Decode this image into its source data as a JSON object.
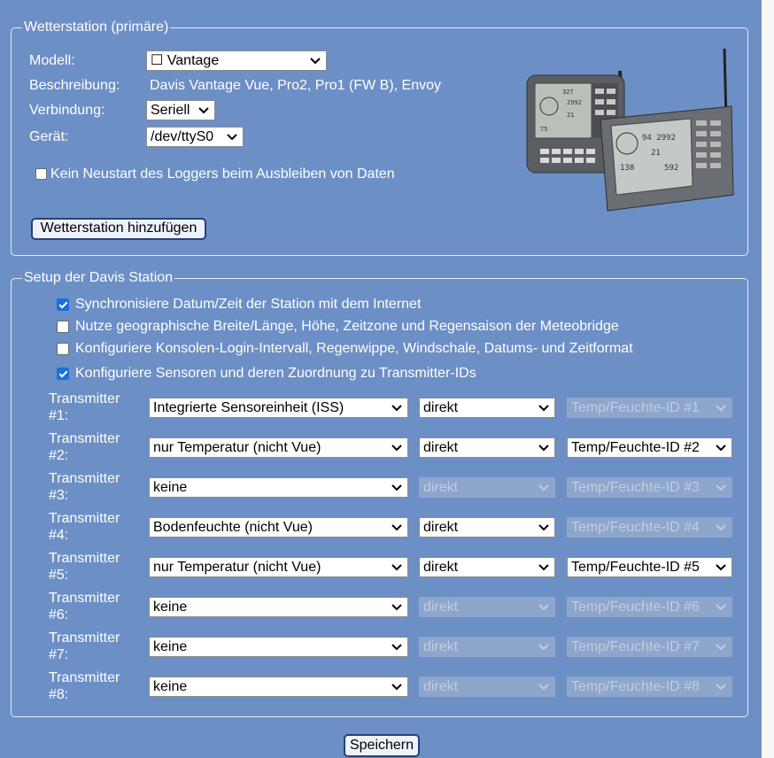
{
  "station": {
    "legend": "Wetterstation (primäre)",
    "model_label": "Modell:",
    "model_value": "☐ Vantage",
    "description_label": "Beschreibung:",
    "description_value": "Davis Vantage Vue, Pro2, Pro1 (FW B), Envoy",
    "connection_label": "Verbindung:",
    "connection_value": "Seriell",
    "device_label": "Gerät:",
    "device_value": "/dev/ttyS0",
    "no_restart_label": "Kein Neustart des Loggers beim Ausbleiben von Daten",
    "no_restart_checked": false,
    "add_button": "Wetterstation hinzufügen",
    "image_name": "davis-vantage-console-image"
  },
  "setup": {
    "legend": "Setup der Davis Station",
    "options": [
      {
        "label": "Synchronisiere Datum/Zeit der Station mit dem Internet",
        "checked": true
      },
      {
        "label": "Nutze geographische Breite/Länge, Höhe, Zeitzone und Regensaison der Meteobridge",
        "checked": false
      },
      {
        "label": "Konfiguriere Konsolen-Login-Intervall, Regenwippe, Windschale, Datums- und Zeitformat",
        "checked": false
      },
      {
        "label": "Konfiguriere Sensoren und deren Zuordnung zu Transmitter-IDs",
        "checked": true
      }
    ],
    "transmitters": [
      {
        "line1": "Transmitter",
        "line2": "#1:",
        "sensor": "Integrierte Sensoreinheit (ISS)",
        "mode": "direkt",
        "mode_disabled": false,
        "id": "Temp/Feuchte-ID #1",
        "id_disabled": true
      },
      {
        "line1": "Transmitter",
        "line2": "#2:",
        "sensor": "nur Temperatur (nicht Vue)",
        "mode": "direkt",
        "mode_disabled": false,
        "id": "Temp/Feuchte-ID #2",
        "id_disabled": false
      },
      {
        "line1": "Transmitter",
        "line2": "#3:",
        "sensor": "keine",
        "mode": "direkt",
        "mode_disabled": true,
        "id": "Temp/Feuchte-ID #3",
        "id_disabled": true
      },
      {
        "line1": "Transmitter",
        "line2": "#4:",
        "sensor": "Bodenfeuchte (nicht Vue)",
        "mode": "direkt",
        "mode_disabled": false,
        "id": "Temp/Feuchte-ID #4",
        "id_disabled": true
      },
      {
        "line1": "Transmitter",
        "line2": "#5:",
        "sensor": "nur Temperatur (nicht Vue)",
        "mode": "direkt",
        "mode_disabled": false,
        "id": "Temp/Feuchte-ID #5",
        "id_disabled": false
      },
      {
        "line1": "Transmitter",
        "line2": "#6:",
        "sensor": "keine",
        "mode": "direkt",
        "mode_disabled": true,
        "id": "Temp/Feuchte-ID #6",
        "id_disabled": true
      },
      {
        "line1": "Transmitter",
        "line2": "#7:",
        "sensor": "keine",
        "mode": "direkt",
        "mode_disabled": true,
        "id": "Temp/Feuchte-ID #7",
        "id_disabled": true
      },
      {
        "line1": "Transmitter",
        "line2": "#8:",
        "sensor": "keine",
        "mode": "direkt",
        "mode_disabled": true,
        "id": "Temp/Feuchte-ID #8",
        "id_disabled": true
      }
    ]
  },
  "save_button": "Speichern",
  "colors": {
    "background": "#6c8fc6",
    "checkbox_checked": "#1a6fdc",
    "button_border": "#27407a"
  }
}
